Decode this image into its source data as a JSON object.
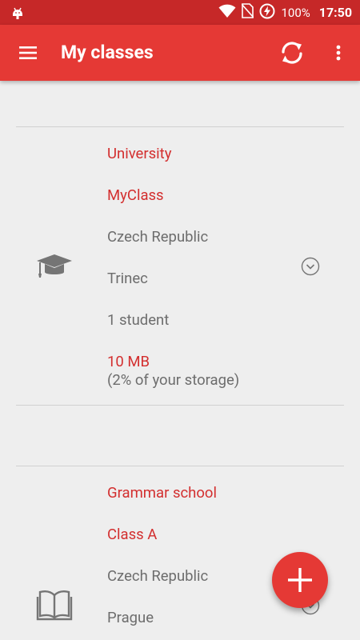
{
  "status_bar": {
    "battery": "100%",
    "time": "17:50"
  },
  "app_bar": {
    "title": "My classes"
  },
  "classes": [
    {
      "type_icon": "graduation-cap-icon",
      "school_type": "University",
      "name": "MyClass",
      "country": "Czech Republic",
      "city": "Trinec",
      "students": "1 student",
      "storage_size": "10 MB",
      "storage_note": "(2% of your storage)"
    },
    {
      "type_icon": "open-book-icon",
      "school_type": "Grammar school",
      "name": "Class A",
      "country": "Czech Republic",
      "city": "Prague"
    }
  ],
  "colors": {
    "accent": "#e53935",
    "status_bar": "#c62828",
    "accent_text": "#d32f2f",
    "background": "#eeeeee"
  },
  "fab": {
    "icon": "plus-icon"
  }
}
